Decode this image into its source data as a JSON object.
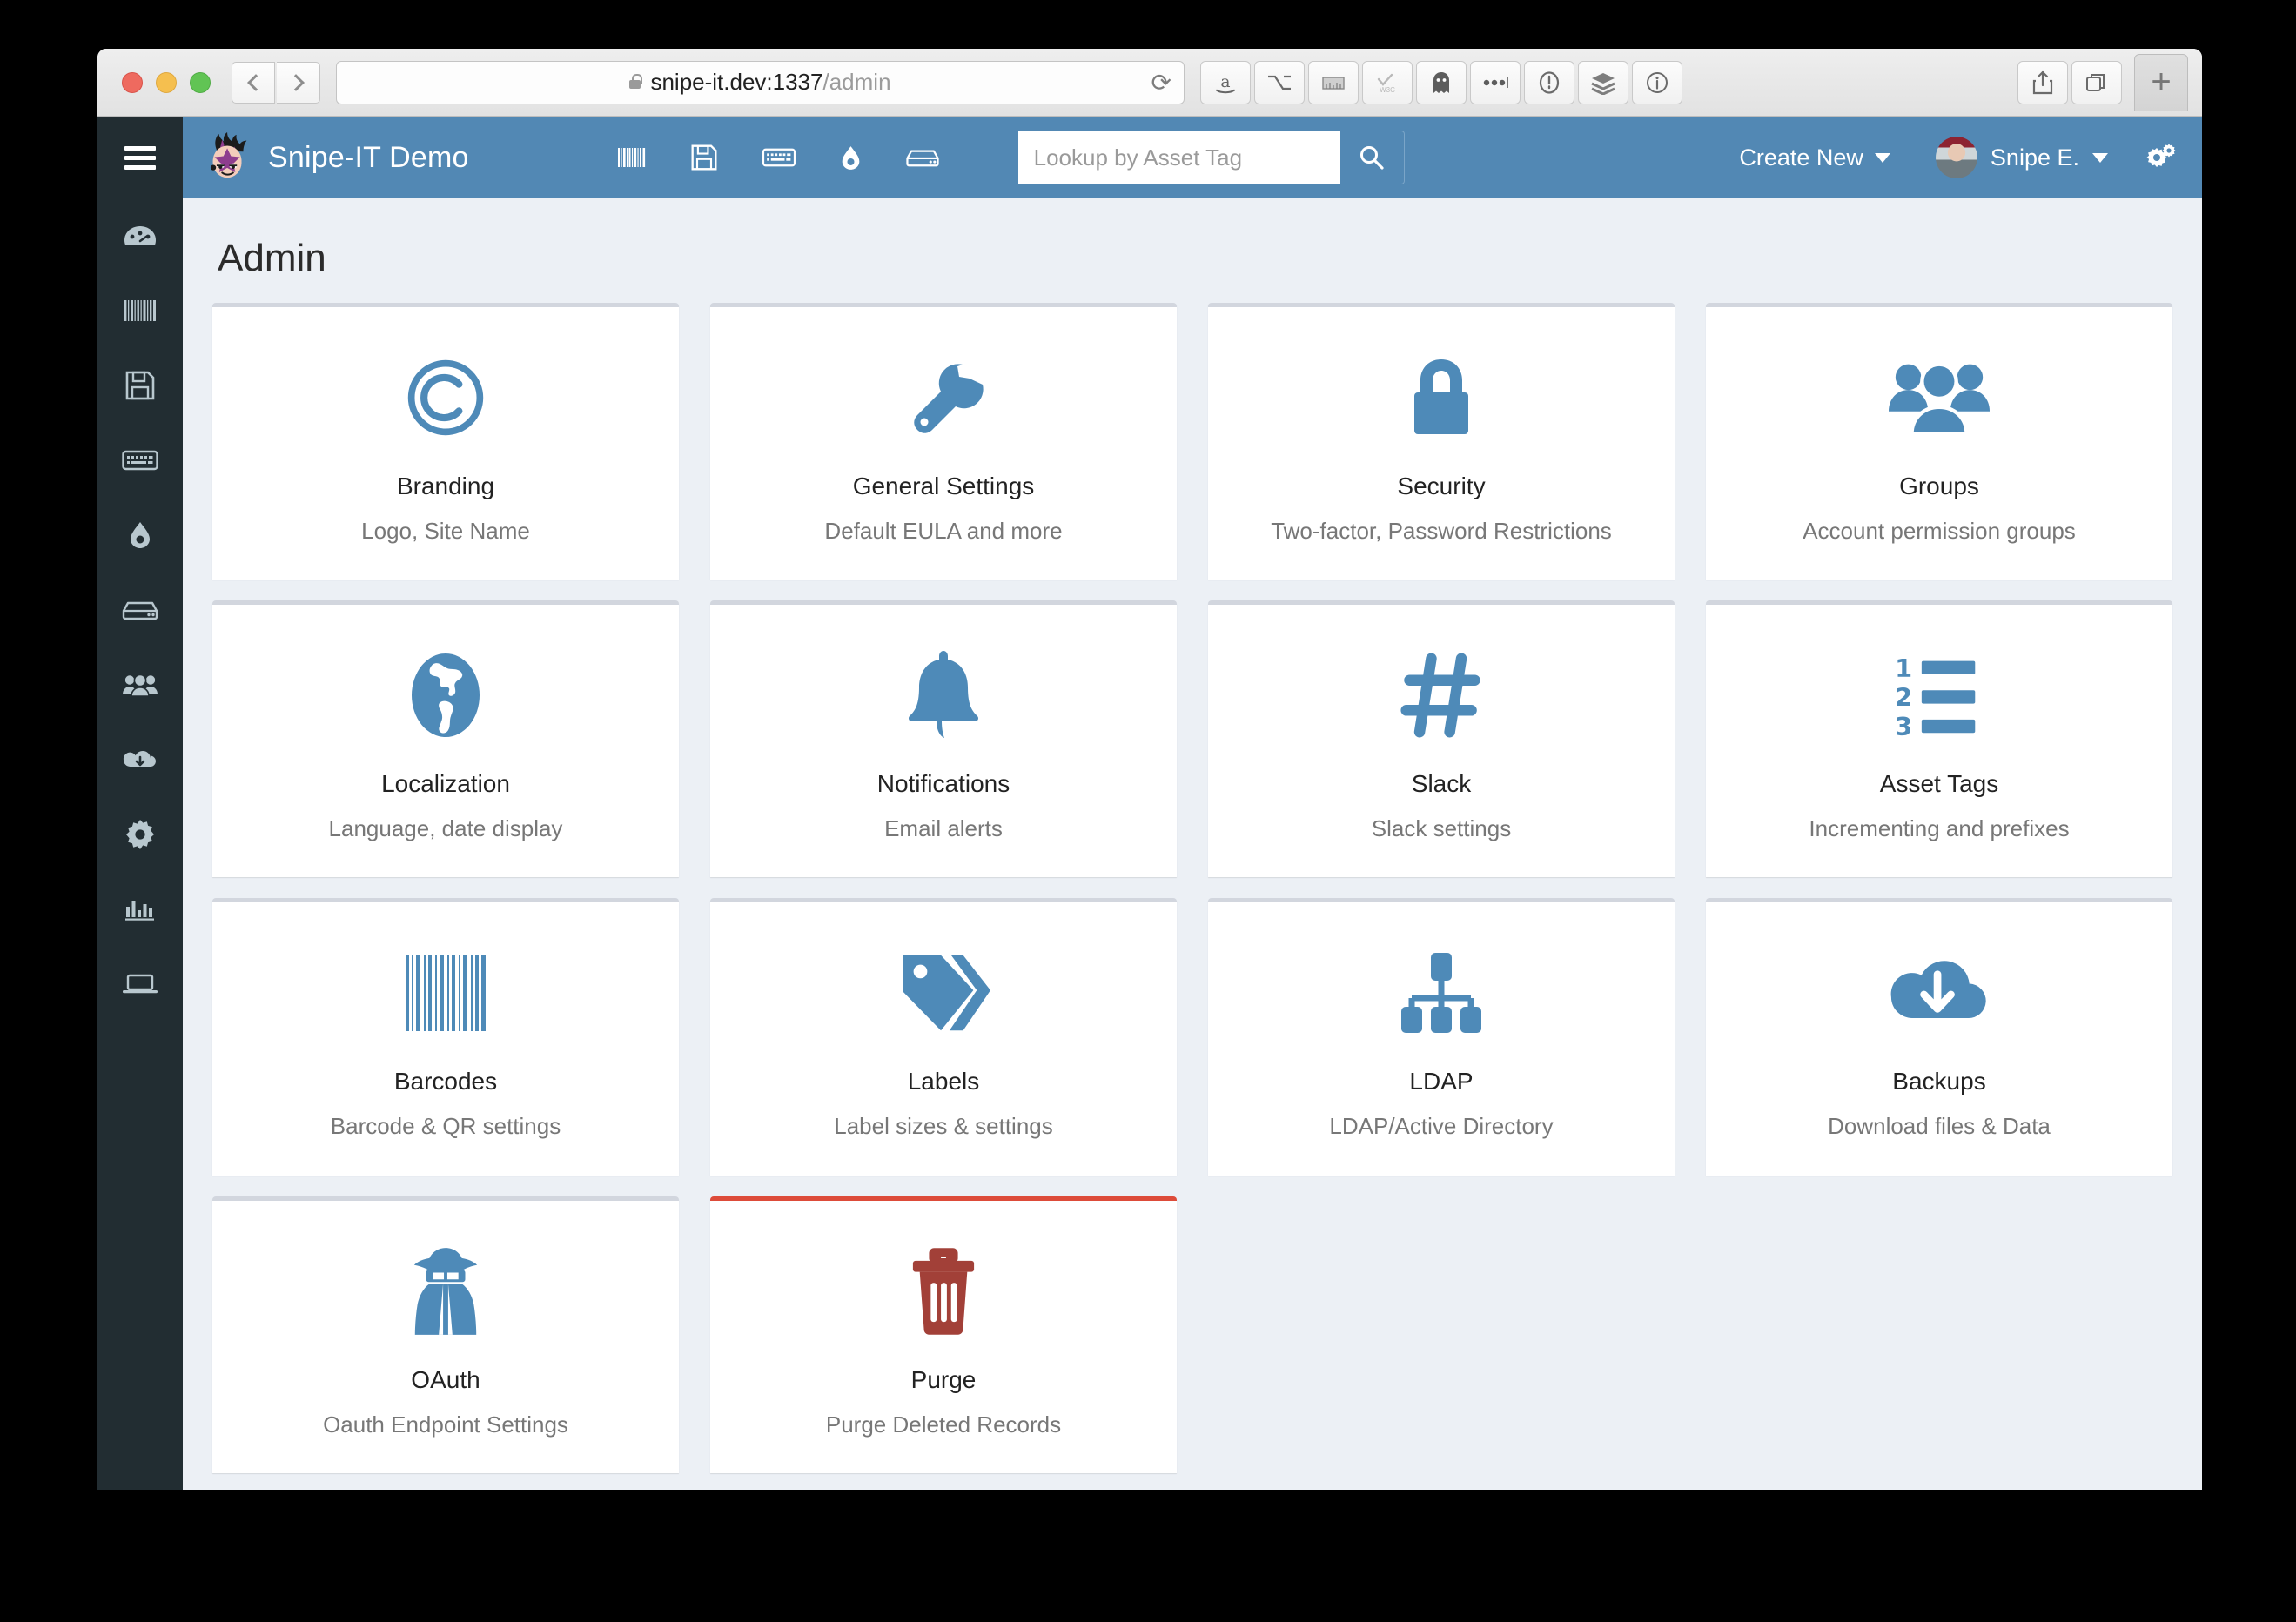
{
  "browser": {
    "url_host": "snipe-it.dev:1337",
    "url_path": "/admin",
    "reload_glyph": "⟳",
    "back_label": "Back",
    "forward_label": "Forward",
    "new_tab_label": "+",
    "extensions": [
      {
        "name": "amazon-icon",
        "label": "a"
      },
      {
        "name": "option-key-icon",
        "label": "⌥"
      },
      {
        "name": "ruler-icon",
        "label": "ruler"
      },
      {
        "name": "w3c-validator-icon",
        "label": "W3C"
      },
      {
        "name": "ghostery-icon",
        "label": "ghost"
      },
      {
        "name": "more-extensions-icon",
        "label": "•••"
      }
    ],
    "right_tools": [
      {
        "name": "onepassword-icon",
        "label": "1Password"
      },
      {
        "name": "buffer-layers-icon",
        "label": "Buffer"
      },
      {
        "name": "info-icon",
        "label": "Info"
      },
      {
        "name": "share-icon",
        "label": "Share"
      },
      {
        "name": "show-tabs-icon",
        "label": "Tabs"
      }
    ]
  },
  "sidebar": {
    "menu_toggle_label": "Toggle navigation",
    "items": [
      {
        "name": "sidebar-item-dashboard",
        "icon": "dashboard-icon",
        "label": "Dashboard"
      },
      {
        "name": "sidebar-item-assets",
        "icon": "barcode-icon",
        "label": "Assets"
      },
      {
        "name": "sidebar-item-licenses",
        "icon": "floppy-disk-icon",
        "label": "Licenses"
      },
      {
        "name": "sidebar-item-accessories",
        "icon": "keyboard-icon",
        "label": "Accessories"
      },
      {
        "name": "sidebar-item-consumables",
        "icon": "droplet-icon",
        "label": "Consumables"
      },
      {
        "name": "sidebar-item-components",
        "icon": "hard-drive-icon",
        "label": "Components"
      },
      {
        "name": "sidebar-item-people",
        "icon": "users-icon",
        "label": "People"
      },
      {
        "name": "sidebar-item-import",
        "icon": "cloud-download-icon",
        "label": "Import"
      },
      {
        "name": "sidebar-item-settings",
        "icon": "gear-icon",
        "label": "Settings"
      },
      {
        "name": "sidebar-item-reports",
        "icon": "bar-chart-icon",
        "label": "Reports"
      },
      {
        "name": "sidebar-item-requestable",
        "icon": "laptop-icon",
        "label": "Requestable Assets"
      }
    ]
  },
  "header": {
    "brand_name": "Snipe-IT Demo",
    "nav_icons": [
      {
        "name": "nav-assets-icon",
        "icon": "barcode-icon",
        "label": "Assets"
      },
      {
        "name": "nav-licenses-icon",
        "icon": "floppy-disk-icon",
        "label": "Licenses"
      },
      {
        "name": "nav-accessories-icon",
        "icon": "keyboard-icon",
        "label": "Accessories"
      },
      {
        "name": "nav-consumables-icon",
        "icon": "droplet-icon",
        "label": "Consumables"
      },
      {
        "name": "nav-components-icon",
        "icon": "hard-drive-icon",
        "label": "Components"
      }
    ],
    "search_placeholder": "Lookup by Asset Tag",
    "search_value": "",
    "search_button_label": "Search",
    "create_new_label": "Create New",
    "user_name": "Snipe E.",
    "settings_label": "Settings"
  },
  "main": {
    "page_title": "Admin",
    "cards": [
      {
        "name": "admin-card-branding",
        "icon": "copyright-icon",
        "title": "Branding",
        "subtitle": "Logo, Site Name",
        "accent": "#d2d6de"
      },
      {
        "name": "admin-card-general-settings",
        "icon": "wrench-icon",
        "title": "General Settings",
        "subtitle": "Default EULA and more",
        "accent": "#d2d6de"
      },
      {
        "name": "admin-card-security",
        "icon": "lock-icon",
        "title": "Security",
        "subtitle": "Two-factor, Password Restrictions",
        "accent": "#d2d6de"
      },
      {
        "name": "admin-card-groups",
        "icon": "group-users-icon",
        "title": "Groups",
        "subtitle": "Account permission groups",
        "accent": "#d2d6de"
      },
      {
        "name": "admin-card-localization",
        "icon": "globe-icon",
        "title": "Localization",
        "subtitle": "Language, date display",
        "accent": "#d2d6de"
      },
      {
        "name": "admin-card-notifications",
        "icon": "bell-icon",
        "title": "Notifications",
        "subtitle": "Email alerts",
        "accent": "#d2d6de"
      },
      {
        "name": "admin-card-slack",
        "icon": "hashtag-icon",
        "title": "Slack",
        "subtitle": "Slack settings",
        "accent": "#d2d6de"
      },
      {
        "name": "admin-card-asset-tags",
        "icon": "numbered-list-icon",
        "title": "Asset Tags",
        "subtitle": "Incrementing and prefixes",
        "accent": "#d2d6de"
      },
      {
        "name": "admin-card-barcodes",
        "icon": "barcode-icon",
        "title": "Barcodes",
        "subtitle": "Barcode & QR settings",
        "accent": "#d2d6de"
      },
      {
        "name": "admin-card-labels",
        "icon": "tags-icon",
        "title": "Labels",
        "subtitle": "Label sizes & settings",
        "accent": "#d2d6de"
      },
      {
        "name": "admin-card-ldap",
        "icon": "sitemap-icon",
        "title": "LDAP",
        "subtitle": "LDAP/Active Directory",
        "accent": "#d2d6de"
      },
      {
        "name": "admin-card-backups",
        "icon": "cloud-download-icon",
        "title": "Backups",
        "subtitle": "Download files & Data",
        "accent": "#d2d6de"
      },
      {
        "name": "admin-card-oauth",
        "icon": "secret-agent-icon",
        "title": "OAuth",
        "subtitle": "Oauth Endpoint Settings",
        "accent": "#d2d6de"
      },
      {
        "name": "admin-card-purge",
        "icon": "trash-icon",
        "title": "Purge",
        "subtitle": "Purge Deleted Records",
        "accent": "#dd4b39"
      }
    ]
  },
  "colors": {
    "brand_blue": "#5288b4",
    "icon_blue": "#4e8ab8",
    "sidebar_dark": "#222d32",
    "page_bg": "#ecf0f5",
    "danger_red": "#dd4b39",
    "trash_red": "#a24038"
  }
}
